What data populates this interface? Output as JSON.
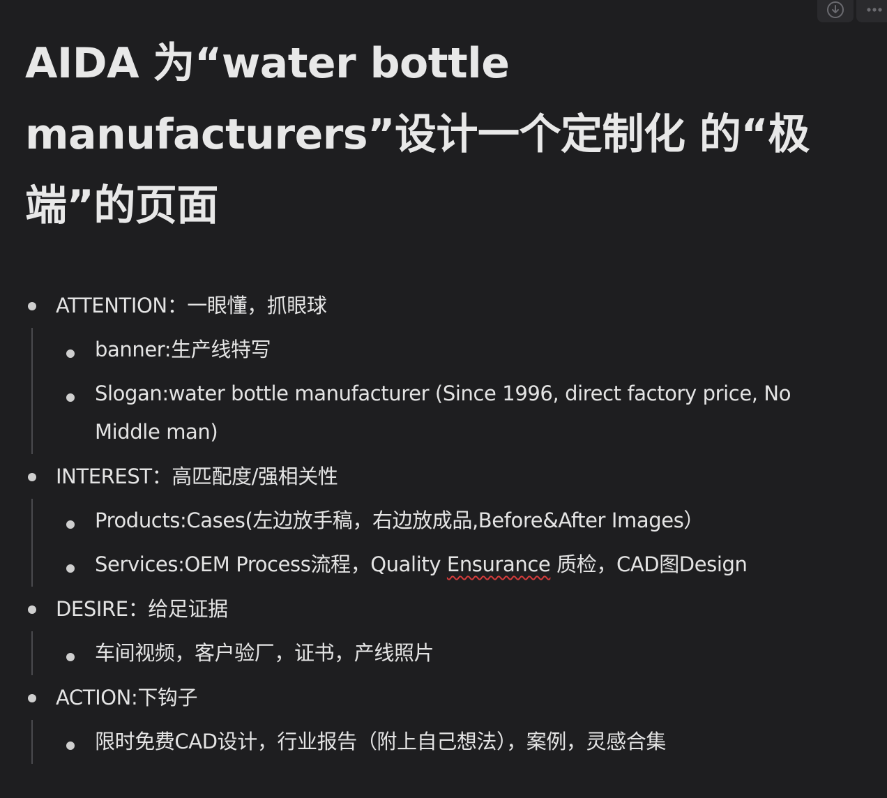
{
  "toolbar": {
    "download_icon": "download-circle-icon",
    "more_icon": "more-dots-icon"
  },
  "title": "AIDA 为“water bottle manufacturers”设计一个定制化 的“极端”的页面",
  "sections": [
    {
      "label": "ATTENTION：一眼懂，抓眼球",
      "children": [
        {
          "text": "banner:生产线特写"
        },
        {
          "text": "Slogan:water bottle manufacturer (Since 1996, direct factory price, No Middle man)"
        }
      ]
    },
    {
      "label": "INTEREST：高匹配度/强相关性",
      "children": [
        {
          "text": "Products:Cases(左边放手稿，右边放成品,Before&After Images）"
        },
        {
          "text_before": "Services:OEM Process流程，Quality ",
          "misspelled": "Ensurance",
          "text_after": " 质检，CAD图Design"
        }
      ]
    },
    {
      "label": "DESIRE：给足证据",
      "children": [
        {
          "text": "车间视频，客户验厂，证书，产线照片"
        }
      ]
    },
    {
      "label": "ACTION:下钩子",
      "children": [
        {
          "text": "限时免费CAD设计，行业报告（附上自己想法），案例，灵感合集"
        }
      ]
    }
  ],
  "colors": {
    "background": "#1e1e20",
    "text": "#e4e4e4",
    "guide_line": "#4a4a4e",
    "spellcheck_underline": "#d23b3b"
  }
}
